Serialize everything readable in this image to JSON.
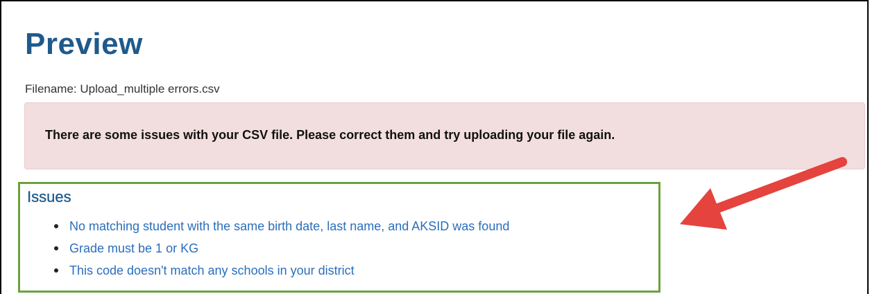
{
  "page": {
    "title": "Preview",
    "filename_text": "Filename: Upload_multiple errors.csv"
  },
  "alert": {
    "message": "There are some issues with your CSV file. Please correct them and try uploading your file again.",
    "background_color": "#f2dede"
  },
  "issues": {
    "heading": "Issues",
    "items": [
      {
        "text": "No matching student with the same birth date, last name, and AKSID was found"
      },
      {
        "text": "Grade must be 1 or KG"
      },
      {
        "text": "This code doesn't match any schools in your district"
      }
    ],
    "highlight_color": "#6aa23c",
    "link_color": "#2a6ebb"
  },
  "annotation": {
    "arrow_icon": "arrow-left-icon",
    "arrow_color": "#e5433d"
  }
}
